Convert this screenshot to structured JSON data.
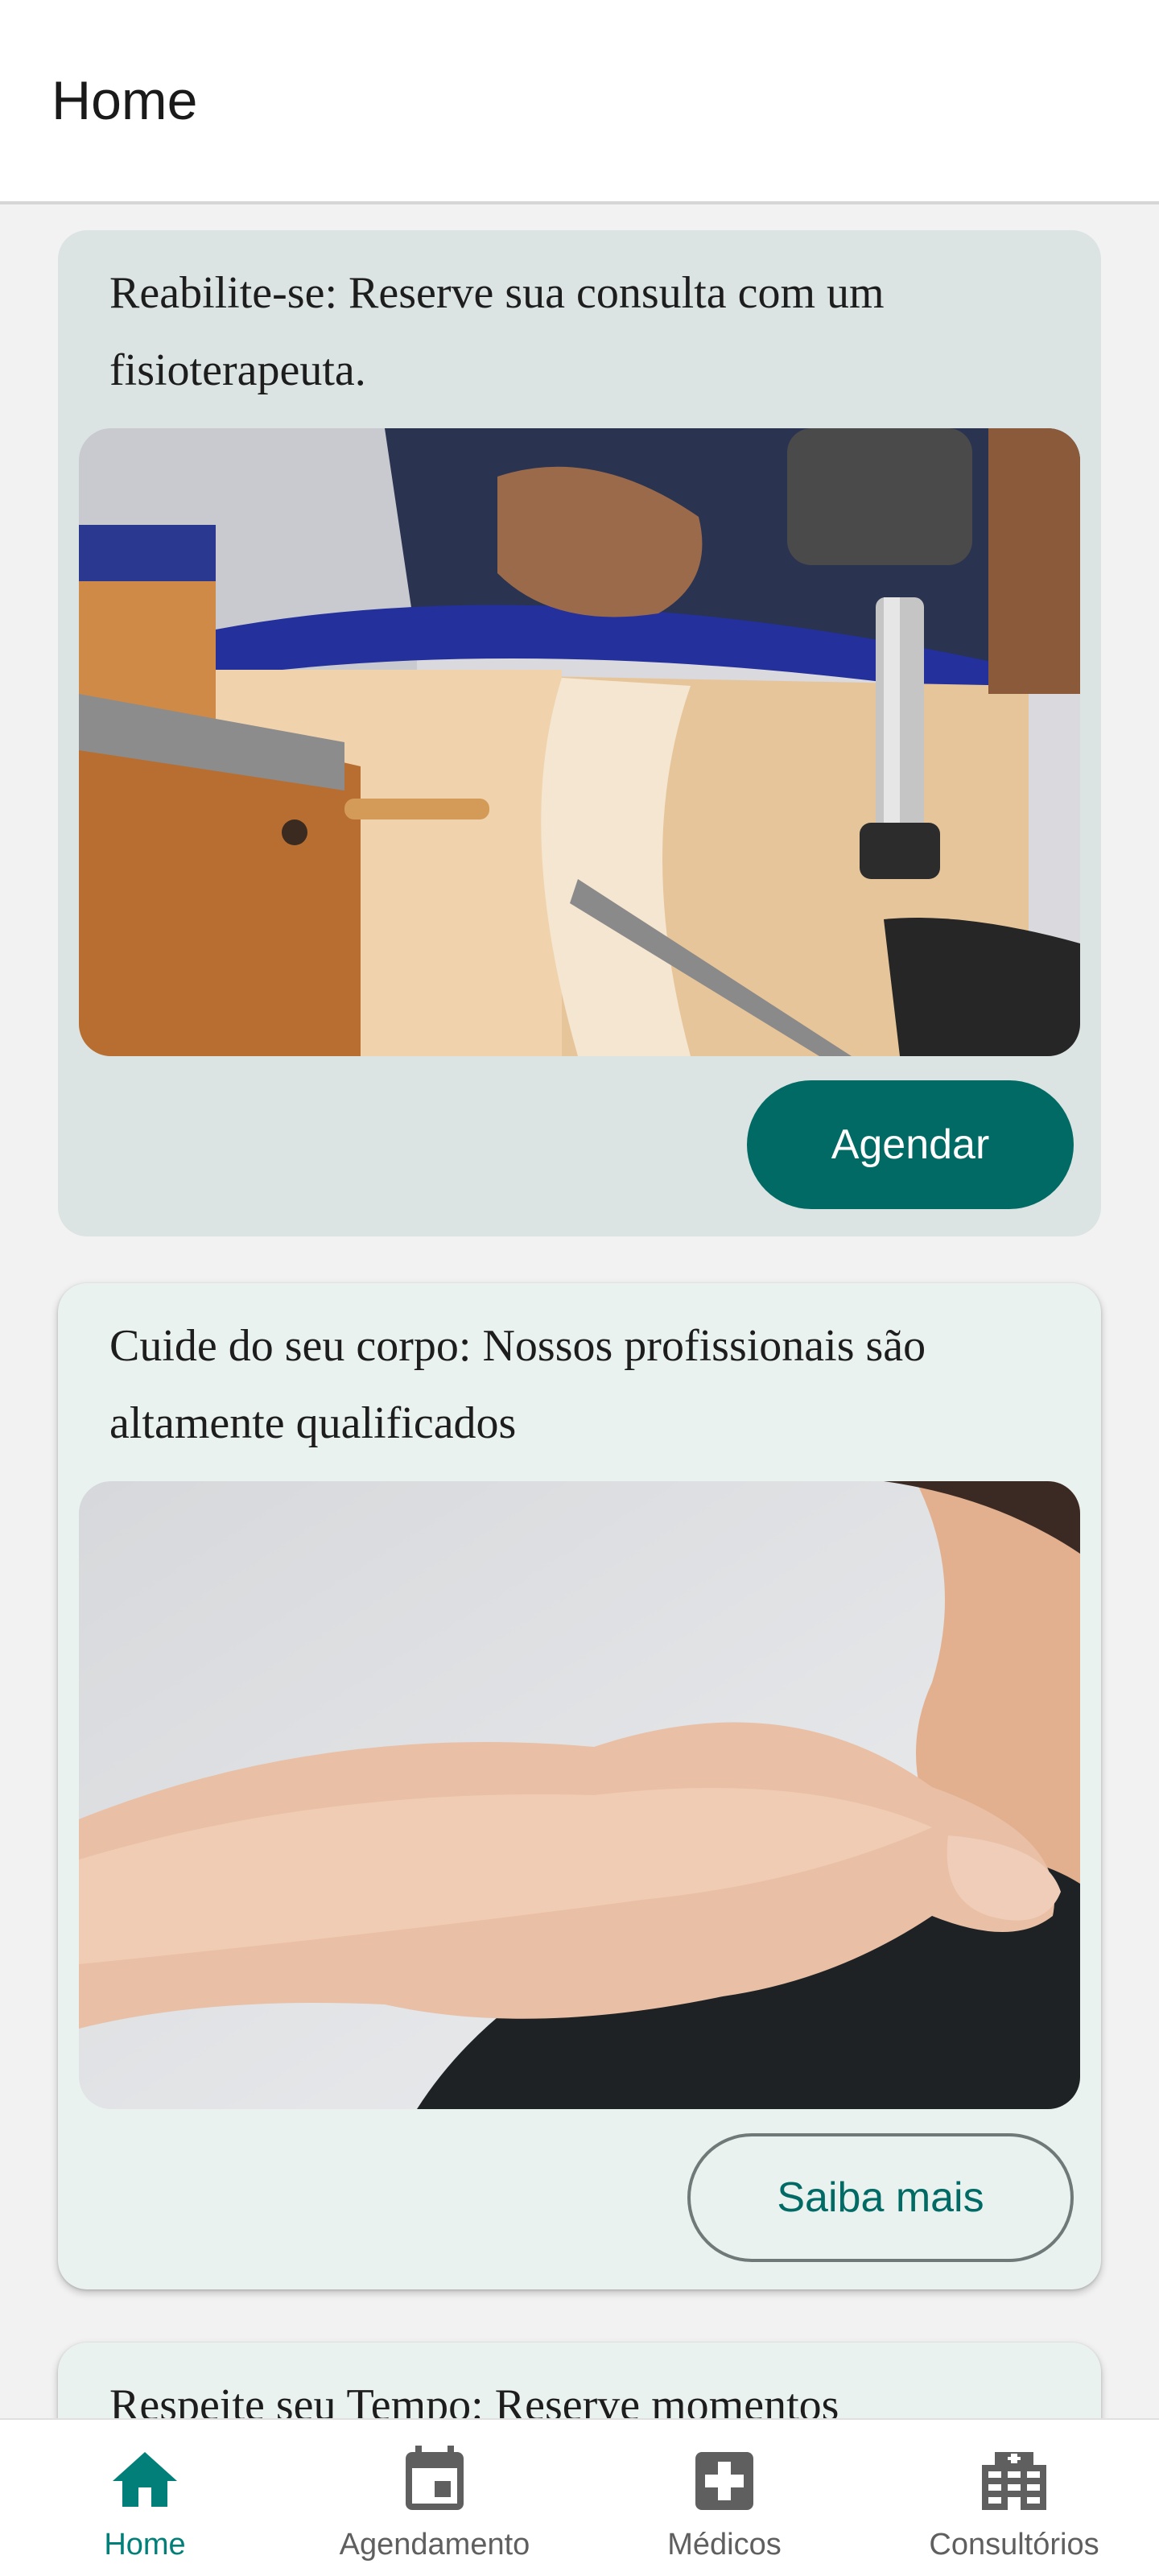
{
  "app_bar": {
    "title": "Home"
  },
  "cards": [
    {
      "title": "Reabilite-se: Reserve sua consulta com um fisioterapeuta.",
      "button_label": "Agendar"
    },
    {
      "title": "Cuide do seu corpo: Nossos profissionais são altamente qualificados",
      "button_label": "Saiba mais"
    },
    {
      "title": "Respeite seu Tempo: Reserve momentos"
    }
  ],
  "bottom_nav": {
    "items": [
      {
        "label": "Home",
        "icon": "home-icon",
        "active": true
      },
      {
        "label": "Agendamento",
        "icon": "calendar-icon",
        "active": false
      },
      {
        "label": "Médicos",
        "icon": "medical-cross-icon",
        "active": false
      },
      {
        "label": "Consultórios",
        "icon": "hospital-building-icon",
        "active": false
      }
    ]
  },
  "colors": {
    "primary": "#016a64",
    "nav_active": "#017f78",
    "filled_card": "#dbe4e3",
    "elevated_card": "#eaf2f0",
    "background": "#f2f2f2"
  }
}
